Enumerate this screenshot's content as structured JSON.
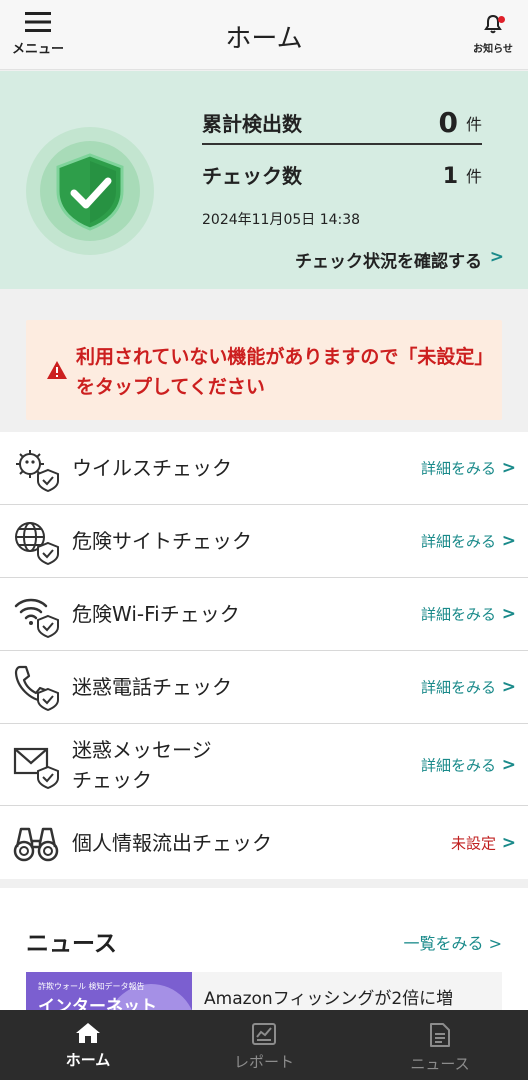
{
  "header": {
    "menu_label": "メニュー",
    "title": "ホーム",
    "notice_label": "お知らせ"
  },
  "summary": {
    "detections_label": "累計検出数",
    "detections_value": "0",
    "detections_unit": "件",
    "checks_label": "チェック数",
    "checks_value": "1",
    "checks_unit": "件",
    "date": "2024年11月05日 14:38",
    "status_link": "チェック状況を確認する",
    "status_chevron": ">"
  },
  "warning": {
    "text": "利用されていない機能がありますので「未設定」をタップしてください"
  },
  "checks": [
    {
      "label": "ウイルスチェック",
      "action": "詳細をみる",
      "icon": "virus-shield-icon"
    },
    {
      "label": "危険サイトチェック",
      "action": "詳細をみる",
      "icon": "globe-shield-icon"
    },
    {
      "label": "危険Wi-Fiチェック",
      "action": "詳細をみる",
      "icon": "wifi-shield-icon"
    },
    {
      "label": "迷惑電話チェック",
      "action": "詳細をみる",
      "icon": "phone-shield-icon"
    },
    {
      "label": "迷惑メッセージ\nチェック",
      "action": "詳細をみる",
      "icon": "mail-shield-icon"
    },
    {
      "label": "個人情報流出チェック",
      "action": "未設定",
      "icon": "binoculars-icon"
    }
  ],
  "news": {
    "heading": "ニュース",
    "more": "一覧をみる >",
    "item": {
      "thumb_caption": "詐欺ウォール 検知データ報告",
      "thumb_title": "インターネット",
      "title": "Amazonフィッシングが2倍に増"
    }
  },
  "nav": {
    "home": "ホーム",
    "report": "レポート",
    "news": "ニュース"
  },
  "colors": {
    "accent": "#1a8a8a",
    "warning": "#cc1f1f",
    "summary_bg": "#d6ece2",
    "shield_green": "#2e9e4a",
    "nav_bg": "#2c2c2c"
  }
}
